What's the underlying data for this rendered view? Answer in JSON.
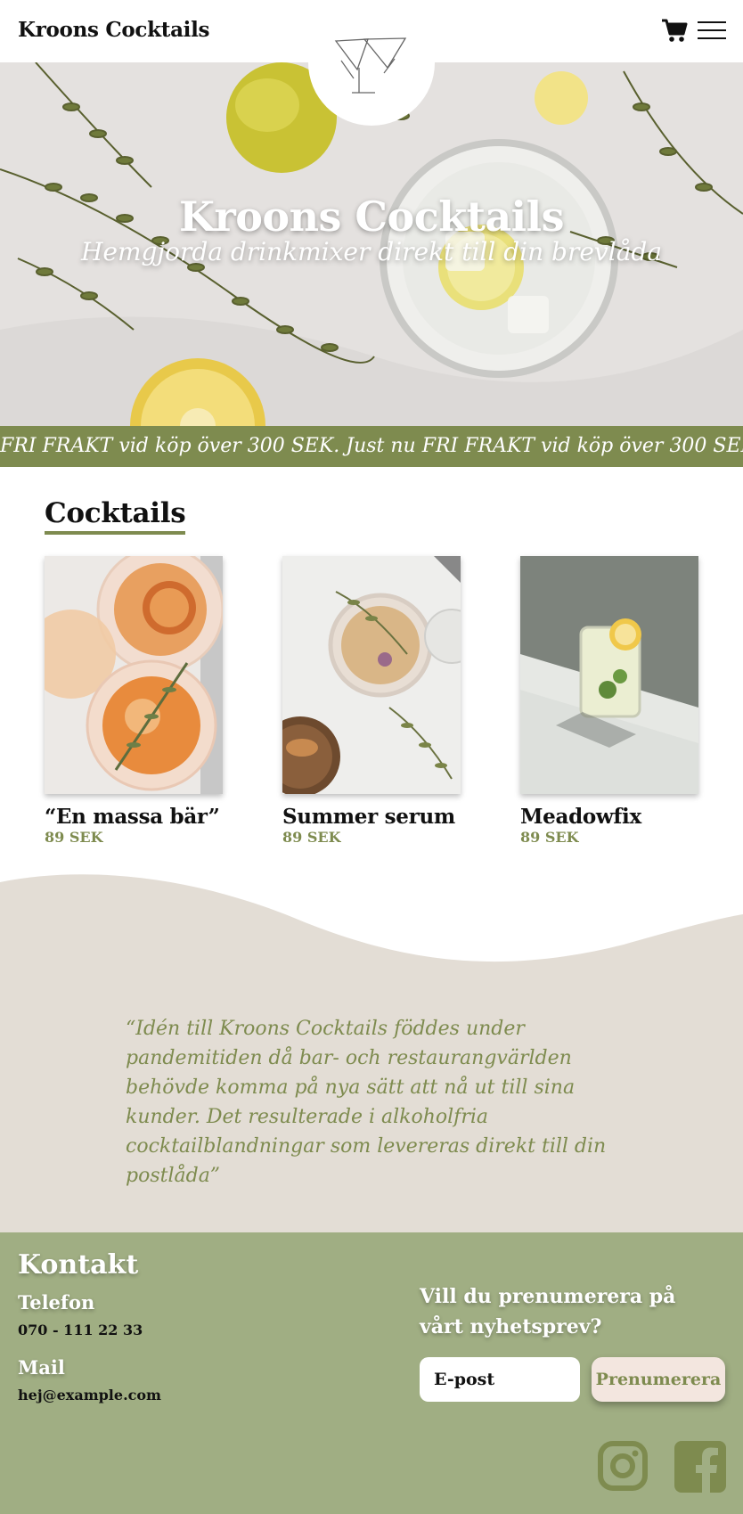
{
  "header": {
    "brand": "Kroons Cocktails",
    "cart_icon": "cart-icon",
    "menu_icon": "hamburger-menu-icon",
    "logo_icon": "cocktail-glass-logo-icon"
  },
  "hero": {
    "title": "Kroons Cocktails",
    "subtitle": "Hemgjorda drinkmixer direkt till din brevlåda"
  },
  "banner": {
    "text": "FRI FRAKT vid köp över 300 SEK. Just nu FRI FRAKT vid köp över 300 SEK.  Just nu"
  },
  "cocktails": {
    "title": "Cocktails",
    "items": [
      {
        "name": "“En massa bär”",
        "price": "89 SEK"
      },
      {
        "name": "Summer serum",
        "price": "89 SEK"
      },
      {
        "name": "Meadowfix",
        "price": "89 SEK"
      }
    ]
  },
  "quote": {
    "text": "“Idén till Kroons Cocktails föddes under pandemitiden då bar- och restaurangvärlden behövde komma på nya sätt att nå ut till sina kunder. Det resulterade i alkoholfria cocktailblandningar som levereras direkt till din postlåda”"
  },
  "footer": {
    "title": "Kontakt",
    "phone_label": "Telefon",
    "phone": "070 - 111 22 33",
    "mail_label": "Mail",
    "mail": "hej@example.com",
    "newsletter_question": "Vill du prenumerera på vårt nyhetsprev?",
    "email_placeholder": "E-post",
    "subscribe_label": "Prenumerera",
    "social": [
      "instagram-icon",
      "facebook-icon"
    ]
  },
  "colors": {
    "accent_green": "#7e8b4f",
    "footer_green": "#a0ae83",
    "quote_bg": "#e3ddd5",
    "button_bg": "#f3e6df"
  }
}
